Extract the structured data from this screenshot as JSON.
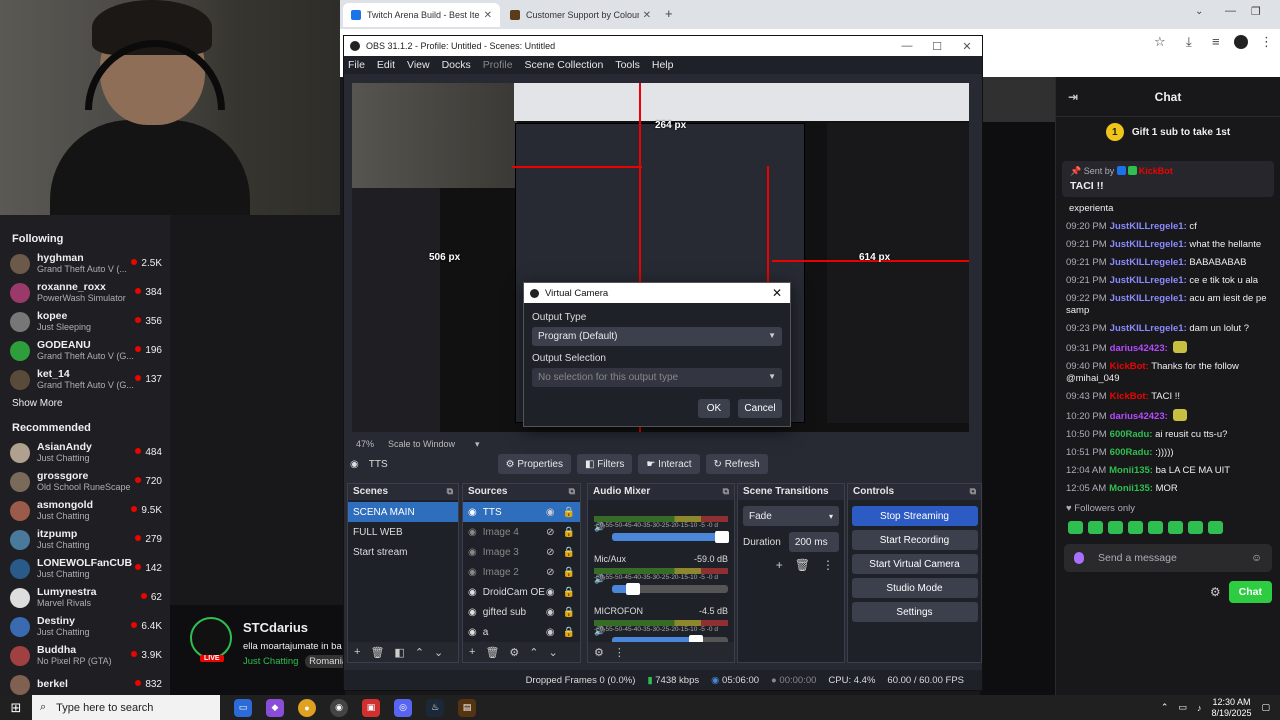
{
  "chrome": {
    "tabs": [
      {
        "label": "Twitch Arena Build - Best Items",
        "active": true,
        "favicon_color": "#1a73e8"
      },
      {
        "label": "Customer Support by Colourpop",
        "active": false,
        "favicon_color": "#5a3b1a"
      }
    ]
  },
  "twitch_left": {
    "following_title": "Following",
    "following": [
      {
        "name": "hyghman",
        "game": "Grand Theft Auto V (...",
        "viewers": "2.5K",
        "avatar_color": "#6b5a4a"
      },
      {
        "name": "roxanne_roxx",
        "game": "PowerWash Simulator",
        "viewers": "384",
        "avatar_color": "#9b3a6a"
      },
      {
        "name": "kopee",
        "game": "Just Sleeping",
        "viewers": "356",
        "avatar_color": "#777777"
      },
      {
        "name": "GODEANU",
        "game": "Grand Theft Auto V (G...",
        "viewers": "196",
        "avatar_color": "#2e9d3b"
      },
      {
        "name": "ket_14",
        "game": "Grand Theft Auto V (G...",
        "viewers": "137",
        "avatar_color": "#5a4a3a"
      }
    ],
    "show_more": "Show More",
    "recommended_title": "Recommended",
    "recommended": [
      {
        "name": "AsianAndy",
        "game": "Just Chatting",
        "viewers": "484",
        "avatar_color": "#b0a090"
      },
      {
        "name": "grossgore",
        "game": "Old School RuneScape",
        "viewers": "720",
        "avatar_color": "#7a6a5a"
      },
      {
        "name": "asmongold",
        "game": "Just Chatting",
        "viewers": "9.5K",
        "avatar_color": "#9b5a4a"
      },
      {
        "name": "itzpump",
        "game": "Just Chatting",
        "viewers": "279",
        "avatar_color": "#4a7a9b"
      },
      {
        "name": "LONEWOLFanCUB",
        "game": "Just Chatting",
        "viewers": "142",
        "avatar_color": "#2a5a8a"
      },
      {
        "name": "Lumynestra",
        "game": "Marvel Rivals",
        "viewers": "62",
        "avatar_color": "#dddddd"
      },
      {
        "name": "Destiny",
        "game": "Just Chatting",
        "viewers": "6.4K",
        "avatar_color": "#3a6ab0"
      },
      {
        "name": "Buddha",
        "game": "No Pixel RP (GTA)",
        "viewers": "3.9K",
        "avatar_color": "#a04040"
      },
      {
        "name": "berkel",
        "game": "",
        "viewers": "832",
        "avatar_color": "#806050"
      }
    ]
  },
  "twitch_bottom": {
    "streamer": "STCdarius",
    "description": "ella moartajumate in ba",
    "category": "Just Chatting",
    "tag": "Romania",
    "live_badge": "LIVE"
  },
  "obs": {
    "title": "OBS 31.1.2 - Profile: Untitled - Scenes: Untitled",
    "menu": [
      "File",
      "Edit",
      "View",
      "Docks",
      "Profile",
      "Scene Collection",
      "Tools",
      "Help"
    ],
    "preview_labels": {
      "top": "264 px",
      "left": "506 px",
      "right": "614 px"
    },
    "zoom": "47%",
    "scale_option": "Scale to Window",
    "selected_source": "TTS",
    "toolbar": {
      "properties": "Properties",
      "filters": "Filters",
      "interact": "Interact",
      "refresh": "Refresh"
    },
    "docks": {
      "scenes": "Scenes",
      "sources": "Sources",
      "audio_mixer": "Audio Mixer",
      "transitions": "Scene Transitions",
      "controls": "Controls"
    },
    "scenes": [
      "SCENA MAIN",
      "FULL WEB",
      "Start stream"
    ],
    "sources": [
      {
        "name": "TTS",
        "dim": false,
        "icon": "browser-icon"
      },
      {
        "name": "Image 4",
        "dim": true,
        "icon": "image-icon"
      },
      {
        "name": "Image 3",
        "dim": true,
        "icon": "image-icon"
      },
      {
        "name": "Image 2",
        "dim": true,
        "icon": "image-icon"
      },
      {
        "name": "DroidCam OE",
        "dim": false,
        "icon": "camera-icon"
      },
      {
        "name": "gifted sub",
        "dim": false,
        "icon": "browser-icon"
      },
      {
        "name": "a",
        "dim": false,
        "icon": "browser-icon"
      }
    ],
    "mixer": [
      {
        "name": "",
        "db": "",
        "level": 0.95
      },
      {
        "name": "Mic/Aux",
        "db": "-59.0 dB",
        "level": 0.18
      },
      {
        "name": "MICROFON",
        "db": "-4.5 dB",
        "level": 0.72
      }
    ],
    "mixer_scale": "-60-55-50-45-40-35-30-25-20-15-10 -5 -0 d",
    "transition": "Fade",
    "duration_label": "Duration",
    "duration": "200 ms",
    "controls": [
      "Stop Streaming",
      "Start Recording",
      "Start Virtual Camera",
      "Studio Mode",
      "Settings"
    ],
    "status": {
      "dropped": "Dropped Frames 0 (0.0%)",
      "bitrate": "7438 kbps",
      "stream_time": "05:06:00",
      "rec_time": "00:00:00",
      "cpu": "CPU: 4.4%",
      "fps": "60.00 / 60.00 FPS"
    }
  },
  "vcam_dialog": {
    "title": "Virtual Camera",
    "output_type_label": "Output Type",
    "output_type_value": "Program (Default)",
    "output_selection_label": "Output Selection",
    "output_selection_placeholder": "No selection for this output type",
    "ok": "OK",
    "cancel": "Cancel"
  },
  "chat": {
    "title": "Chat",
    "gift_text": "Gift 1 sub to take 1st",
    "gift_count": "1",
    "pinned_by_prefix": "Sent by",
    "pinned_by": "KickBot",
    "pinned_message": "TACI !!",
    "messages": [
      {
        "time": "",
        "user": "",
        "color": "#efeff1",
        "text": "experienta"
      },
      {
        "time": "09:20 PM",
        "user": "JustKILLregele1:",
        "color": "#8a8aff",
        "text": "cf"
      },
      {
        "time": "09:21 PM",
        "user": "JustKILLregele1:",
        "color": "#8a8aff",
        "text": "what the hellante"
      },
      {
        "time": "09:21 PM",
        "user": "JustKILLregele1:",
        "color": "#8a8aff",
        "text": "BABABABAB"
      },
      {
        "time": "09:21 PM",
        "user": "JustKILLregele1:",
        "color": "#8a8aff",
        "text": "ce e tik tok u ala"
      },
      {
        "time": "09:22 PM",
        "user": "JustKILLregele1:",
        "color": "#8a8aff",
        "text": "acu am iesit de pe samp"
      },
      {
        "time": "09:23 PM",
        "user": "JustKILLregele1:",
        "color": "#8a8aff",
        "text": "dam un lolut ?"
      },
      {
        "time": "09:31 PM",
        "user": "darius42423:",
        "color": "#b44bff",
        "text": ""
      },
      {
        "time": "09:40 PM",
        "user": "KickBot:",
        "color": "#eb0400",
        "text": "Thanks for the follow @mihai_049"
      },
      {
        "time": "09:43 PM",
        "user": "KickBot:",
        "color": "#eb0400",
        "text": "TACI !!"
      },
      {
        "time": "10:20 PM",
        "user": "darius42423:",
        "color": "#b44bff",
        "text": ""
      },
      {
        "time": "10:50 PM",
        "user": "600Radu:",
        "color": "#2fbf50",
        "text": "ai reusit cu tts-u?"
      },
      {
        "time": "10:51 PM",
        "user": "600Radu:",
        "color": "#2fbf50",
        "text": ":)))))"
      },
      {
        "time": "12:04 AM",
        "user": "Monii135:",
        "color": "#2fbf50",
        "text": "ba LA CE MA UIT"
      },
      {
        "time": "12:05 AM",
        "user": "Monii135:",
        "color": "#2fbf50",
        "text": "MOR"
      }
    ],
    "followers_only": "Followers only",
    "input_placeholder": "Send a message",
    "send_button": "Chat"
  },
  "taskbar": {
    "search_placeholder": "Type here to search",
    "time": "12:30 AM",
    "date": "8/19/2025"
  }
}
